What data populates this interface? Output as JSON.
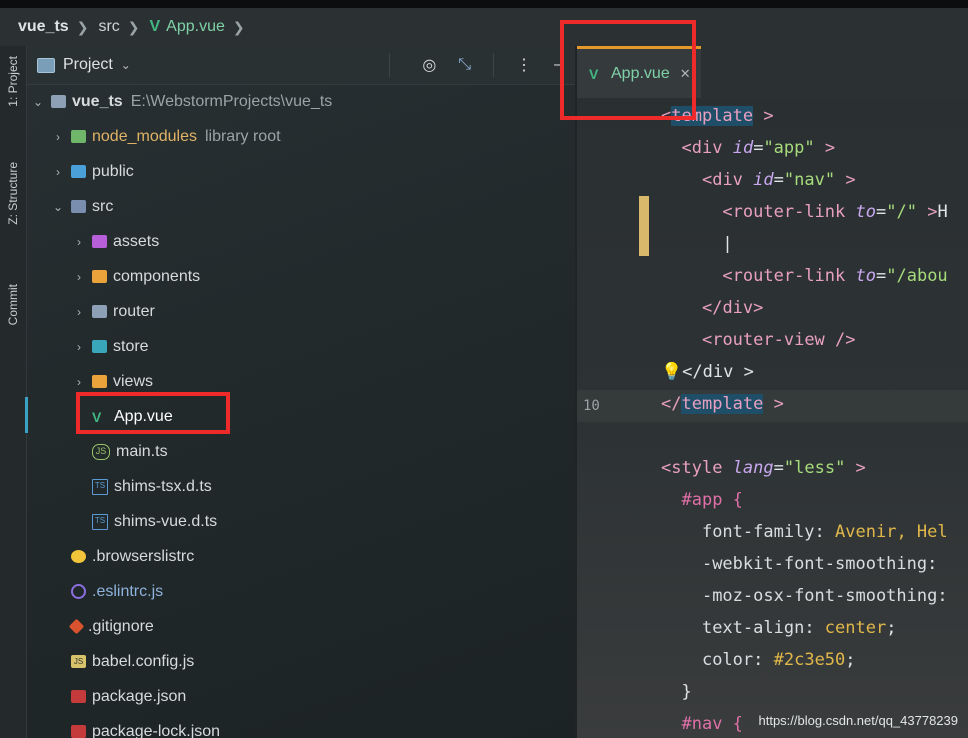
{
  "breadcrumb": {
    "project": "vue_ts",
    "folder": "src",
    "file": "App.vue"
  },
  "sidebar_tabs": {
    "project": "1: Project",
    "structure": "Z: Structure",
    "commit": "Commit"
  },
  "panel": {
    "title": "Project",
    "tools": {
      "target_icon": "target-icon",
      "collapse_icon": "collapse-icon",
      "more_icon": "more-icon",
      "hide_icon": "minus-icon"
    }
  },
  "tree": {
    "root": {
      "name": "vue_ts",
      "path": "E:\\WebstormProjects\\vue_ts"
    },
    "node_modules": {
      "name": "node_modules",
      "note": "library root"
    },
    "public": "public",
    "src": "src",
    "assets": "assets",
    "components": "components",
    "router": "router",
    "store": "store",
    "views": "views",
    "app": "App.vue",
    "main": "main.ts",
    "shims_tsx": "shims-tsx.d.ts",
    "shims_vue": "shims-vue.d.ts",
    "browserslist": ".browserslistrc",
    "eslintrc": ".eslintrc.js",
    "gitignore": ".gitignore",
    "babel": "babel.config.js",
    "package": "package.json",
    "package_lock": "package-lock.json"
  },
  "editor": {
    "tab": "App.vue",
    "line_number": "10",
    "code": {
      "l1": "template",
      "l2a": "div",
      "l2b": "id",
      "l2c": "\"app\"",
      "l3a": "div",
      "l3b": "id",
      "l3c": "\"nav\"",
      "l4a": "router-link",
      "l4b": "to",
      "l4c": "\"/\"",
      "l4d": "H",
      "l5": "|",
      "l6a": "router-link",
      "l6b": "to",
      "l6c": "\"/abou",
      "l7": "/div",
      "l8": "router-view",
      "l9": "</div >",
      "l10": "template",
      "l12a": "style",
      "l12b": "lang",
      "l12c": "\"less\"",
      "l13": "#app {",
      "l14a": "font-family",
      "l14b": "Avenir, Hel",
      "l15": "-webkit-font-smoothing",
      "l16": "-moz-osx-font-smoothing",
      "l17a": "text-align",
      "l17b": "center",
      "l18a": "color",
      "l18b": "#2c3e50",
      "l19": "}",
      "l20": "#nav {"
    }
  },
  "watermark": "https://blog.csdn.net/qq_43778239",
  "colors": {
    "accent_tab": "#e49a2a",
    "vue_green": "#41b883",
    "highlight_box": "#ee2a2a"
  }
}
